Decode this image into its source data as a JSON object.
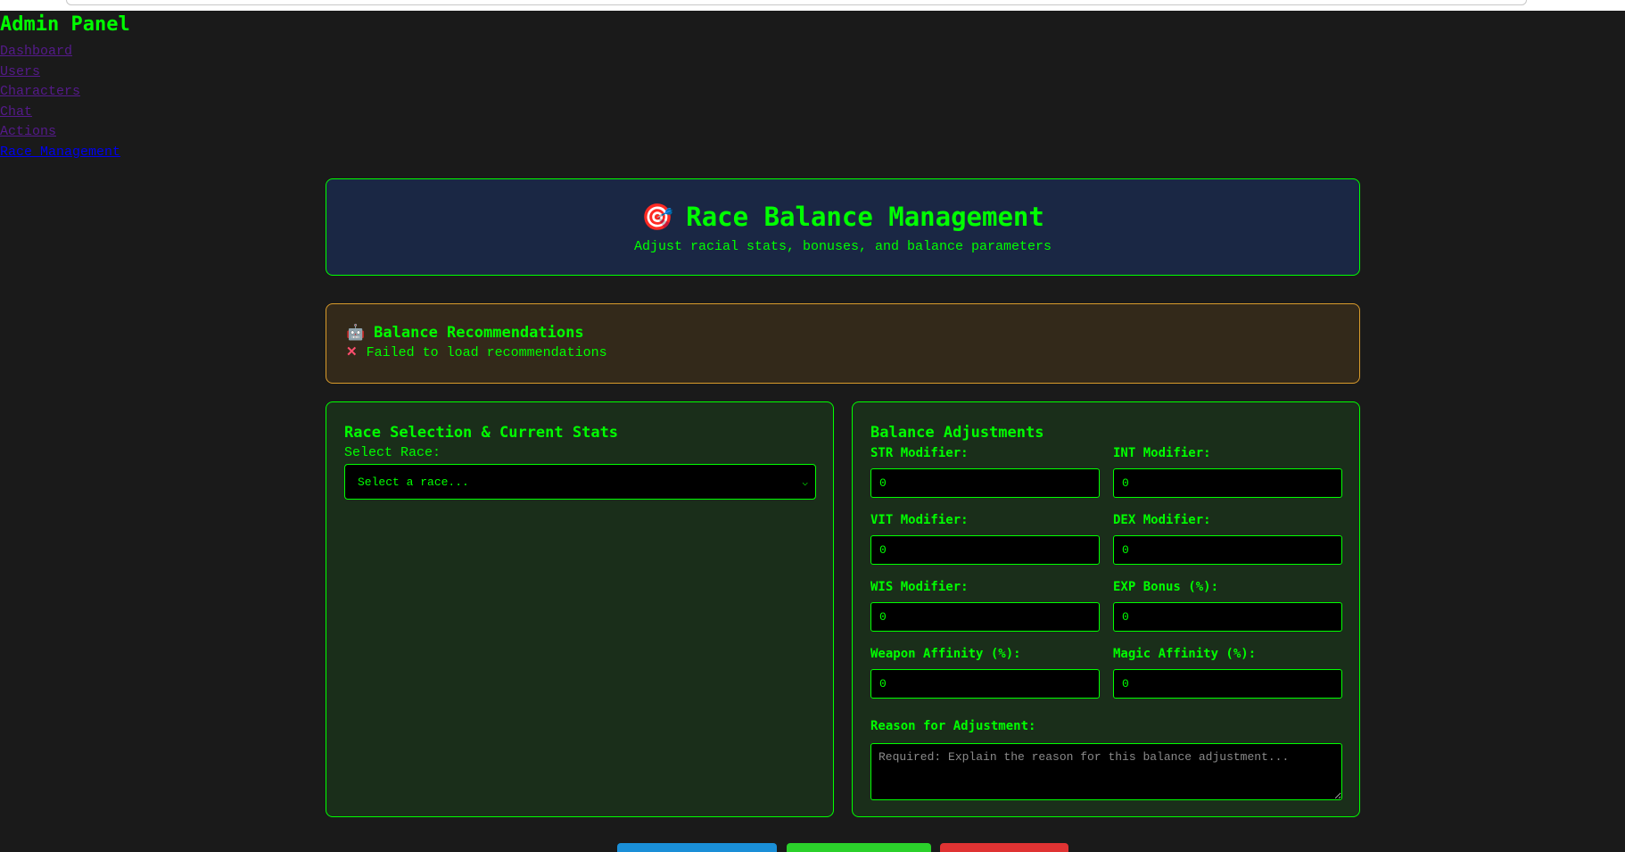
{
  "admin": {
    "title": "Admin Panel",
    "nav": [
      {
        "label": "Dashboard"
      },
      {
        "label": "Users"
      },
      {
        "label": "Characters"
      },
      {
        "label": "Chat"
      },
      {
        "label": "Actions"
      },
      {
        "label": "Race Management"
      }
    ]
  },
  "header": {
    "icon": "target-icon",
    "icon_glyph": "🎯",
    "title": "Race Balance Management",
    "subtitle": "Adjust racial stats, bonuses, and balance parameters"
  },
  "recommendations": {
    "icon": "robot-icon",
    "icon_glyph": "🤖",
    "title": "Balance Recommendations",
    "error_icon": "x-icon",
    "error_glyph": "✕",
    "error_text": "Failed to load recommendations"
  },
  "race_selection": {
    "title": "Race Selection & Current Stats",
    "select_label": "Select Race:",
    "select_value": "Select a race..."
  },
  "adjustments": {
    "title": "Balance Adjustments",
    "fields": [
      {
        "label": "STR Modifier:",
        "value": "0"
      },
      {
        "label": "INT Modifier:",
        "value": "0"
      },
      {
        "label": "VIT Modifier:",
        "value": "0"
      },
      {
        "label": "DEX Modifier:",
        "value": "0"
      },
      {
        "label": "WIS Modifier:",
        "value": "0"
      },
      {
        "label": "EXP Bonus (%):",
        "value": "0"
      },
      {
        "label": "Weapon Affinity (%):",
        "value": "0"
      },
      {
        "label": "Magic Affinity (%):",
        "value": "0"
      }
    ],
    "reason_label": "Reason for Adjustment:",
    "reason_placeholder": "Required: Explain the reason for this balance adjustment..."
  },
  "colors": {
    "accent": "#00ff00",
    "background": "#1a1a1a",
    "header_bg": "#1a2744",
    "warning_bg": "#33291a",
    "warning_border": "#d99b2b",
    "panel_bg": "#1a2e1a",
    "button_blue": "#1a8fd8",
    "button_green": "#2bd12b",
    "button_red": "#e03333"
  }
}
